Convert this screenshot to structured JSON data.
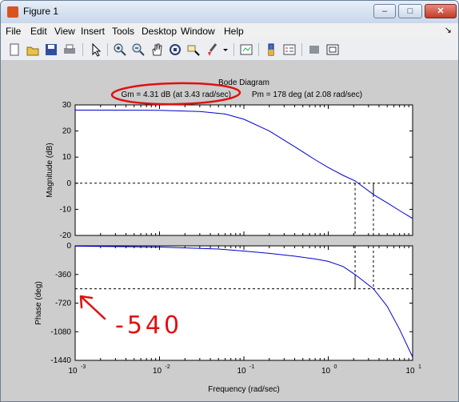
{
  "window": {
    "title": "Figure 1",
    "minimize_label": "–",
    "maximize_label": "□",
    "close_label": "✕"
  },
  "menu": {
    "items": [
      "File",
      "Edit",
      "View",
      "Insert",
      "Tools",
      "Desktop",
      "Window",
      "Help"
    ],
    "dock_symbol": "↘"
  },
  "toolbar": {
    "icons": [
      "new-figure-icon",
      "open-file-icon",
      "save-icon",
      "print-icon",
      "edit-plot-arrow-icon",
      "zoom-in-icon",
      "zoom-out-icon",
      "pan-hand-icon",
      "rotate-3d-icon",
      "data-cursor-icon",
      "brush-icon",
      "brush-dropdown-icon",
      "link-plot-icon",
      "insert-colorbar-icon",
      "insert-legend-icon",
      "hide-plot-tools-icon",
      "show-plot-tools-icon"
    ]
  },
  "plot": {
    "title": "Bode Diagram",
    "subtitle_gm": "Gm = 4.31 dB (at 3.43 rad/sec) ,",
    "subtitle_pm": "Pm = 178 deg (at 2.08 rad/sec)",
    "xlabel": "Frequency  (rad/sec)",
    "mag_ylabel": "Magnitude (dB)",
    "phase_ylabel": "Phase (deg)",
    "mag_ticks": [
      "30",
      "20",
      "10",
      "0",
      "-10",
      "-20"
    ],
    "phase_ticks": [
      "0",
      "-360",
      "-720",
      "-1080",
      "-1440"
    ],
    "x_ticks": [
      {
        "base": "10",
        "exp": "-3"
      },
      {
        "base": "10",
        "exp": "-2"
      },
      {
        "base": "10",
        "exp": "-1"
      },
      {
        "base": "10",
        "exp": "0"
      },
      {
        "base": "10",
        "exp": "1"
      }
    ],
    "curve_color": "#0000d0",
    "annotation_color": "#e01010",
    "annotation_text": "-540"
  },
  "chart_data": [
    {
      "type": "line",
      "title": "Bode Diagram",
      "ylabel": "Magnitude (dB)",
      "xlabel": "Frequency  (rad/sec)",
      "xscale": "log",
      "xlim": [
        0.001,
        10
      ],
      "ylim": [
        -20,
        30
      ],
      "grid": false,
      "series": [
        {
          "x": [
            0.001,
            0.003,
            0.01,
            0.03,
            0.06,
            0.1,
            0.2,
            0.4,
            0.7,
            1.0,
            1.5,
            2.08,
            3.43,
            5,
            7,
            10
          ],
          "y": [
            28,
            28,
            27.9,
            27.5,
            26.5,
            24.5,
            20,
            14,
            9,
            6,
            3,
            0.9,
            -4.31,
            -7.5,
            -10.5,
            -13.5
          ]
        }
      ],
      "reference_lines": {
        "y_dB": 0,
        "gm_frequency": 3.43,
        "pm_frequency": 2.08
      }
    },
    {
      "type": "line",
      "ylabel": "Phase (deg)",
      "xlabel": "Frequency  (rad/sec)",
      "xscale": "log",
      "xlim": [
        0.001,
        10
      ],
      "ylim": [
        -1440,
        0
      ],
      "grid": false,
      "series": [
        {
          "x": [
            0.001,
            0.01,
            0.05,
            0.1,
            0.2,
            0.4,
            0.7,
            1.0,
            1.5,
            2.08,
            3.43,
            5,
            7,
            10
          ],
          "y": [
            -4,
            -15,
            -40,
            -65,
            -95,
            -130,
            -165,
            -195,
            -260,
            -362,
            -540,
            -760,
            -1050,
            -1400
          ]
        }
      ],
      "reference_lines": {
        "y_deg": -540,
        "gm_frequency": 3.43,
        "pm_frequency": 2.08
      }
    }
  ]
}
